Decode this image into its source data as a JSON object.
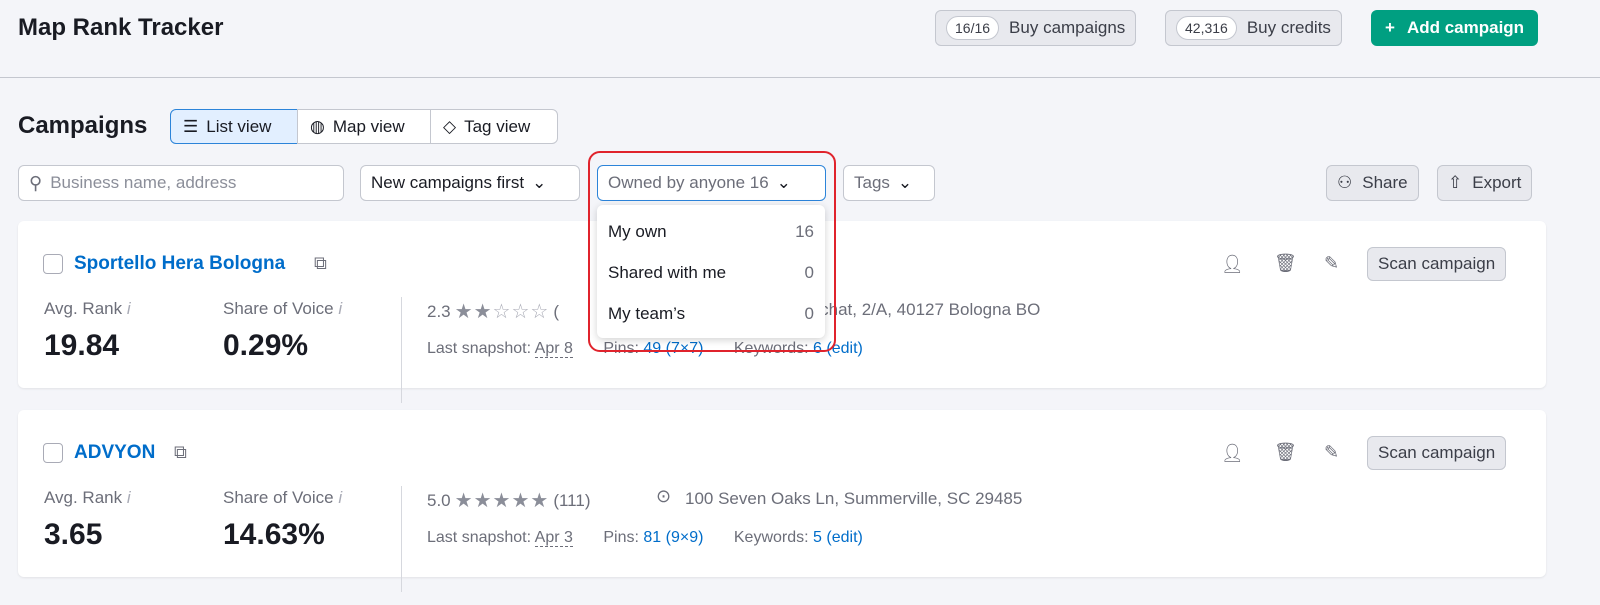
{
  "header": {
    "title": "Map Rank Tracker",
    "campaigns_count": "16/16",
    "buy_campaigns": "Buy campaigns",
    "credits": "42,316",
    "buy_credits": "Buy credits",
    "add_campaign": "Add campaign"
  },
  "toolbar": {
    "heading": "Campaigns",
    "views": [
      "List view",
      "Map view",
      "Tag view"
    ],
    "active_view": "List view",
    "search_placeholder": "Business name, address",
    "sort": "New campaigns first",
    "owner": "Owned by anyone 16",
    "tags": "Tags",
    "share": "Share",
    "export": "Export"
  },
  "owner_menu": [
    {
      "label": "My own",
      "count": "16"
    },
    {
      "label": "Shared with me",
      "count": "0"
    },
    {
      "label": "My team’s",
      "count": "0"
    }
  ],
  "labels": {
    "avg_rank": "Avg. Rank",
    "sov": "Share of Voice",
    "info": "i",
    "last_snapshot": "Last snapshot:",
    "pins": "Pins:",
    "keywords": "Keywords:",
    "scan": "Scan campaign"
  },
  "campaigns": [
    {
      "name": "Sportello Hera Bologna",
      "avg_rank": "19.84",
      "sov": "0.29%",
      "rating": "2.3",
      "stars": 2,
      "reviews": "(",
      "address": "Pichat, 2/A, 40127 Bologna BO",
      "snapshot": "Apr 8",
      "pins": "49 (7×7)",
      "keywords": "6",
      "edit": "(edit)"
    },
    {
      "name": "ADVYON",
      "avg_rank": "3.65",
      "sov": "14.63%",
      "rating": "5.0",
      "stars": 5,
      "reviews": "(111)",
      "address": "100 Seven Oaks Ln, Summerville, SC 29485",
      "snapshot": "Apr 3",
      "pins": "81 (9×9)",
      "keywords": "5",
      "edit": "(edit)"
    }
  ],
  "colors": {
    "accent": "#009f81",
    "link": "#006dca",
    "highlight": "#e0232c"
  }
}
